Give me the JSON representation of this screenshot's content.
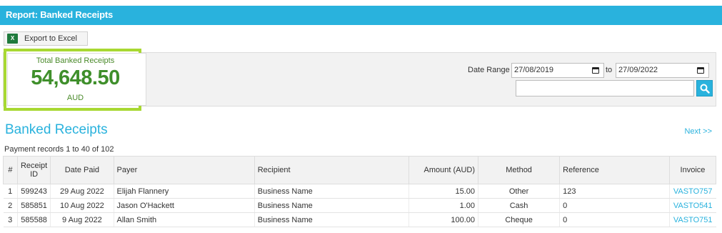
{
  "header": {
    "title": "Report: Banked Receipts"
  },
  "toolbar": {
    "export_label": "Export to Excel",
    "excel_badge": "X"
  },
  "summary": {
    "label": "Total Banked Receipts",
    "value": "54,648.50",
    "currency": "AUD"
  },
  "filters": {
    "date_range_label": "Date Range",
    "date_from": "27/08/2019",
    "to_label": "to",
    "date_to": "27/09/2022",
    "search_value": ""
  },
  "section": {
    "title": "Banked Receipts",
    "next_label": "Next >>",
    "records_text": "Payment records 1 to 40 of 102"
  },
  "table": {
    "headers": {
      "num": "#",
      "receipt_id_line1": "Receipt",
      "receipt_id_line2": "ID",
      "date_paid": "Date Paid",
      "payer": "Payer",
      "recipient": "Recipient",
      "amount": "Amount (AUD)",
      "method": "Method",
      "reference": "Reference",
      "invoice": "Invoice"
    },
    "rows": [
      {
        "num": "1",
        "receipt_id": "599243",
        "date_paid": "29 Aug 2022",
        "payer": "Elijah Flannery",
        "recipient": "Business Name",
        "amount": "15.00",
        "method": "Other",
        "reference": "123",
        "invoice": "VASTO757"
      },
      {
        "num": "2",
        "receipt_id": "585851",
        "date_paid": "10 Aug 2022",
        "payer": "Jason O'Hackett",
        "recipient": "Business Name",
        "amount": "1.00",
        "method": "Cash",
        "reference": "0",
        "invoice": "VASTO541"
      },
      {
        "num": "3",
        "receipt_id": "585588",
        "date_paid": "9 Aug 2022",
        "payer": "Allan Smith",
        "recipient": "Business Name",
        "amount": "100.00",
        "method": "Cheque",
        "reference": "0",
        "invoice": "VASTO751"
      }
    ]
  },
  "colors": {
    "accent": "#29b2dd",
    "kpi_border": "#a8d832",
    "kpi_text": "#3f8f2b",
    "excel_green": "#1f7a3c"
  }
}
